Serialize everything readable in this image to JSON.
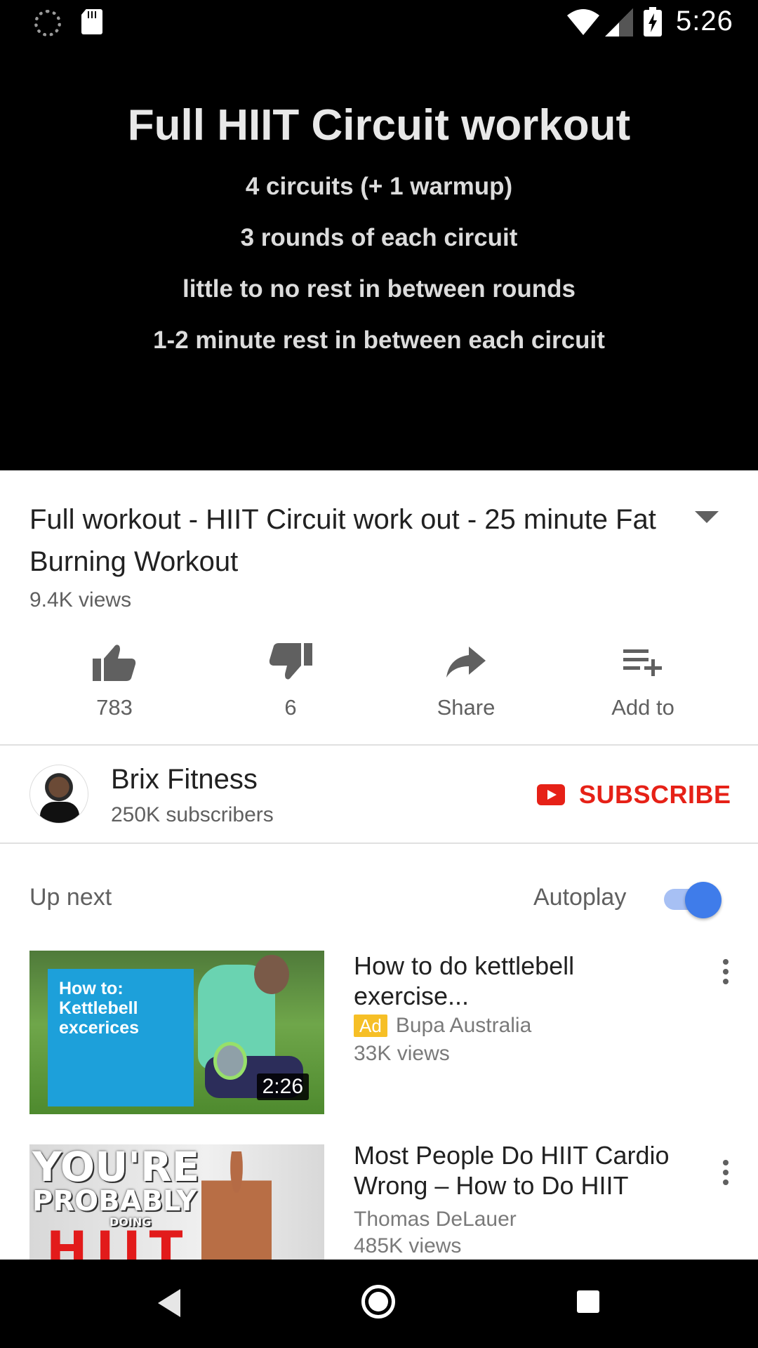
{
  "status_bar": {
    "time": "5:26",
    "icons": [
      "loading-icon",
      "sd-card-icon",
      "wifi-icon",
      "cell-signal-icon",
      "battery-charging-icon"
    ]
  },
  "video": {
    "title": "Full HIIT Circuit workout",
    "lines": [
      "4 circuits (+ 1 warmup)",
      "3 rounds of each circuit",
      "little to no rest in between rounds",
      "1-2 minute rest in between each circuit"
    ]
  },
  "info": {
    "title": "Full workout - HIIT Circuit work out - 25 minute Fat Burning Workout",
    "views": "9.4K views"
  },
  "actions": {
    "like": "783",
    "dislike": "6",
    "share": "Share",
    "add_to": "Add to"
  },
  "channel": {
    "name": "Brix Fitness",
    "subscribers": "250K subscribers",
    "subscribe_label": "SUBSCRIBE"
  },
  "up_next": {
    "label": "Up next",
    "autoplay_label": "Autoplay",
    "autoplay_on": true,
    "items": [
      {
        "title": "How to do kettlebell exercise...",
        "ad_label": "Ad",
        "channel": "Bupa Australia",
        "views": "33K views",
        "duration": "2:26",
        "thumb_text": [
          "How to:",
          "Kettlebell",
          "excerices"
        ]
      },
      {
        "title": "Most People Do HIIT Cardio Wrong – How to Do HIIT",
        "channel": "Thomas DeLauer",
        "views": "485K views",
        "thumb_text": [
          "YOU'RE",
          "PROBABLY",
          "DOING",
          "HIIT"
        ]
      }
    ]
  },
  "colors": {
    "brand_red": "#e62117",
    "toggle_blue": "#3f7cea",
    "ad_yellow": "#f6bf26"
  }
}
